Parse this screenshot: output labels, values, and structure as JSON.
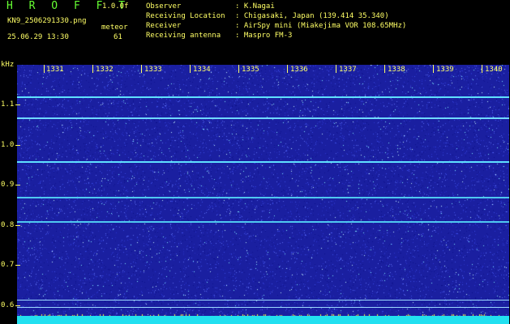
{
  "header": {
    "title": "H R O F F T",
    "version": "1.0.0f",
    "filename": "KN9_2506291330.png",
    "datetime": "25.06.29 13:30",
    "meteor_label": "meteor",
    "meteor_count": "61",
    "info": [
      {
        "label": "Observer",
        "value": ": K.Nagai"
      },
      {
        "label": "Receiving Location",
        "value": ": Chigasaki, Japan (139.414 35.340)"
      },
      {
        "label": "Receiver",
        "value": ": AirSpy mini (Miakejima VOR 108.65MHz)"
      },
      {
        "label": "Receiving antenna",
        "value": ": Maspro FM-3"
      }
    ]
  },
  "axis": {
    "unit": "kHz",
    "y_ticks": [
      "1.1",
      "1.0",
      "0.9",
      "0.8",
      "0.7",
      "0.6"
    ],
    "x_ticks": [
      "1331",
      "1332",
      "1333",
      "1334",
      "1335",
      "1336",
      "1337",
      "1338",
      "1339",
      "1340"
    ]
  },
  "colors": {
    "background": "#000000",
    "plot": "#1a1fa0",
    "text": "#ffff66",
    "title": "#66ff33",
    "signal": "#5fe0ff"
  }
}
